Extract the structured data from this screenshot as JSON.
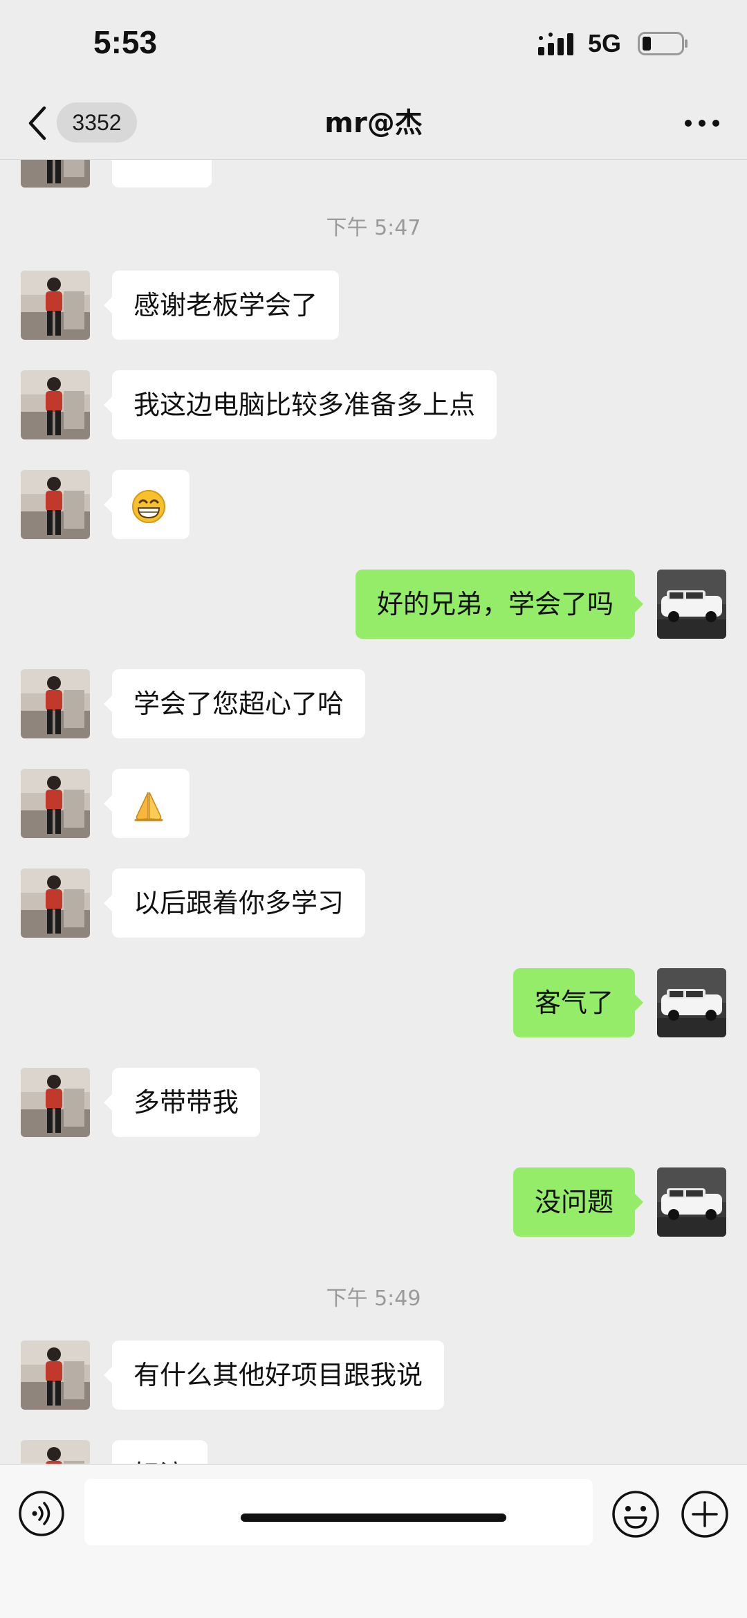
{
  "status_bar": {
    "time": "5:53",
    "network": "5G"
  },
  "nav": {
    "unread_count": "3352",
    "title": "mr@杰"
  },
  "messages": {
    "ts1": "下午 5:47",
    "m1": "感谢老板学会了",
    "m2": "我这边电脑比较多准备多上点",
    "m3_emoji": "grin-emoji",
    "m4": "好的兄弟，学会了吗",
    "m5": "学会了您超心了哈",
    "m6_emoji": "folded-hands-emoji",
    "m7": "以后跟着你多学习",
    "m8": "客气了",
    "m9": "多带带我",
    "m10": "没问题",
    "ts2": "下午 5:49",
    "m11": "有什么其他好项目跟我说",
    "m12_partial": "好滴"
  },
  "input": {
    "placeholder": ""
  },
  "colors": {
    "incoming_bubble": "#ffffff",
    "outgoing_bubble": "#95ec69",
    "background": "#ededed"
  }
}
